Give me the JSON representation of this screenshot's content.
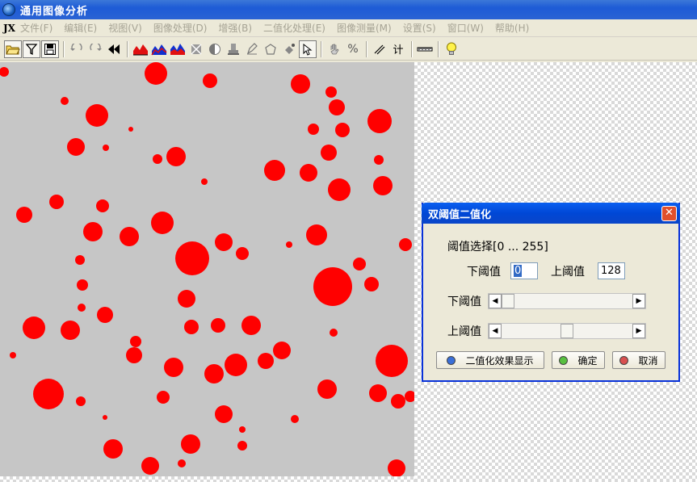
{
  "window": {
    "title": "通用图像分析"
  },
  "menu": {
    "logo": "JX",
    "items": [
      "文件(F)",
      "编辑(E)",
      "视图(V)",
      "图像处理(D)",
      "增强(B)",
      "二值化处理(E)",
      "图像测量(M)",
      "设置(S)",
      "窗口(W)",
      "帮助(H)"
    ]
  },
  "toolbar": {
    "icons": [
      "open-icon",
      "filter-icon",
      "save-icon",
      "undo-icon",
      "redo-icon",
      "rewind-icon",
      "histogram-icon",
      "histogram-blue-icon",
      "histogram-mixed-icon",
      "crop-icon",
      "contrast-icon",
      "stamp-icon",
      "pen-icon",
      "polygon-icon",
      "fill-icon",
      "select-arrow-icon",
      "hand-icon",
      "percent-icon",
      "line-icon",
      "count-icon",
      "ruler-icon",
      "bulb-icon"
    ],
    "percent_label": "%",
    "count_label": "计"
  },
  "dialog": {
    "title": "双阈值二值化",
    "close_label": "✕",
    "range_label": "阈值选择[0 ... 255]",
    "lower_label": "下阈值",
    "upper_label": "上阈值",
    "lower_value": "0",
    "upper_value": "128",
    "lower_slider_label": "下阈值",
    "upper_slider_label": "上阈值",
    "lower_slider_fraction": 0.0,
    "upper_slider_fraction": 0.502,
    "btn_preview": "二值化效果显示",
    "btn_ok": "确定",
    "btn_cancel": "取消",
    "colors": {
      "preview_led": "#3a6fd8",
      "ok_led": "#58c040",
      "cancel_led": "#d85050"
    }
  },
  "image": {
    "particle_color": "#ff0000",
    "background_color": "#c6c6c6"
  }
}
